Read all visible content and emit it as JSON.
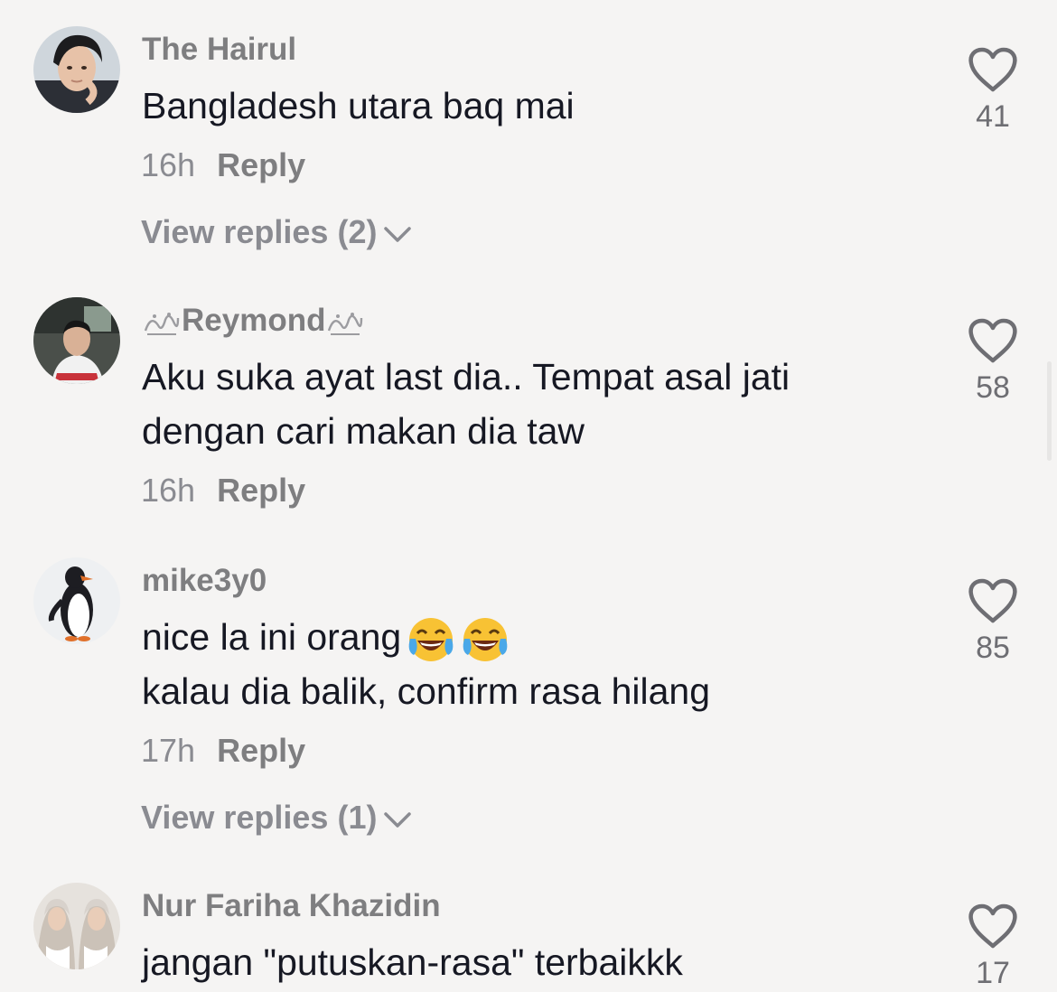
{
  "comments": [
    {
      "username": "The Hairul",
      "text_lines": [
        "Bangladesh utara baq mai"
      ],
      "time": "16h",
      "reply_label": "Reply",
      "view_replies": "View replies (2)",
      "likes": "41"
    },
    {
      "username": "Reymond",
      "text_lines": [
        "Aku suka ayat last dia.. Tempat asal jati",
        "dengan cari makan dia taw"
      ],
      "time": "16h",
      "reply_label": "Reply",
      "likes": "58"
    },
    {
      "username": "mike3y0",
      "text_lines": [
        "nice la ini orang",
        "kalau dia balik, confirm rasa hilang"
      ],
      "emoji": "😂😂",
      "time": "17h",
      "reply_label": "Reply",
      "view_replies": "View replies (1)",
      "likes": "85"
    },
    {
      "username": "Nur Fariha Khazidin",
      "text_lines": [
        "jangan \"putuskan-rasa\" terbaikkk"
      ],
      "likes": "17"
    }
  ],
  "icons": {
    "like": "heart-outline-icon",
    "expand": "chevron-down-icon",
    "emoji": "face-with-tears-of-joy"
  },
  "colors": {
    "background": "#f5f4f3",
    "username": "#7e7e80",
    "text": "#161823",
    "meta": "#8a8b91"
  }
}
